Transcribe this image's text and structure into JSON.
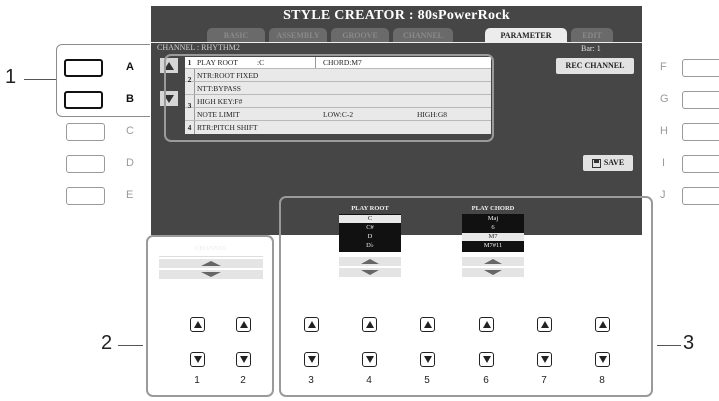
{
  "screen": {
    "title": "STYLE CREATOR : 80sPowerRock",
    "tabs": [
      {
        "label": "BASIC",
        "active": false
      },
      {
        "label": "ASSEMBLY",
        "active": false
      },
      {
        "label": "GROOVE",
        "active": false
      },
      {
        "label": "CHANNEL",
        "active": false
      },
      {
        "label": "PARAMETER",
        "active": true
      },
      {
        "label": "EDIT",
        "active": false
      }
    ],
    "channel_info": "CHANNEL : RHYTHM2",
    "bar_info": "Bar:   1",
    "params": {
      "row1": {
        "num": "1",
        "label": "PLAY ROOT",
        "value": ":C",
        "extra": "CHORD:M7"
      },
      "row2": {
        "num": "2",
        "label": "NTR:ROOT FIXED"
      },
      "row3": {
        "label": "NTT:BYPASS"
      },
      "row4": {
        "num": "3",
        "label": "HIGH KEY:F#"
      },
      "row5": {
        "label": "NOTE LIMIT",
        "low": "LOW:C-2",
        "high": "HIGH:G8"
      },
      "row6": {
        "num": "4",
        "label": "RTR:PITCH SHIFT"
      }
    },
    "rec_channel": "REC CHANNEL",
    "save": "SAVE",
    "channel_label": "CHANNEL",
    "play_root": {
      "label": "PLAY ROOT",
      "items": [
        "C",
        "C#",
        "D",
        "D♭"
      ],
      "selected": "C"
    },
    "play_chord": {
      "label": "PLAY CHORD",
      "items": [
        "Maj",
        "6",
        "M7",
        "M7#11"
      ],
      "selected": "M7"
    }
  },
  "left_buttons": [
    "A",
    "B",
    "C",
    "D",
    "E"
  ],
  "right_buttons": [
    "F",
    "G",
    "H",
    "I",
    "J"
  ],
  "bottom_buttons": [
    "1",
    "2",
    "3",
    "4",
    "5",
    "6",
    "7",
    "8"
  ],
  "callouts": {
    "c1": "1",
    "c2": "2",
    "c3": "3"
  },
  "colors": {
    "screen": "#464646",
    "highlight_border": "#111111",
    "dim_border": "#9a9a9a"
  }
}
